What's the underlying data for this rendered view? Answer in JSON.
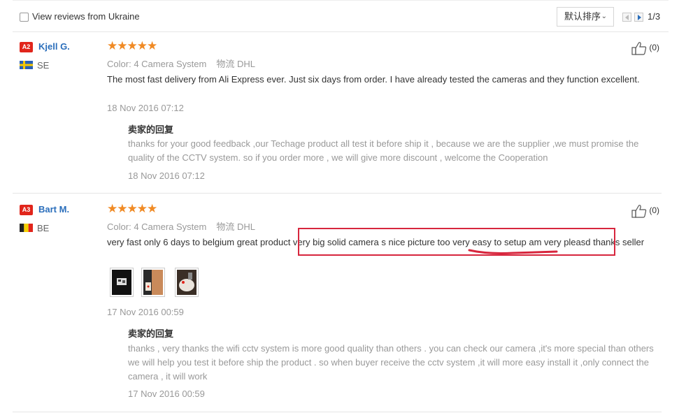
{
  "filter": {
    "label": "View reviews from Ukraine"
  },
  "sort": {
    "label": "默认排序"
  },
  "pagination": {
    "label": "1/3"
  },
  "reviews": [
    {
      "level": "A2",
      "name": "Kjell G.",
      "country": "SE",
      "rating": "★★★★★",
      "color_label": "Color:",
      "color_value": "4 Camera System",
      "ship_label": "物流",
      "ship_value": "DHL",
      "text": "The most fast delivery from Ali Express ever. Just six days from order. I have already tested the cameras and they function excellent.",
      "date": "18 Nov 2016 07:12",
      "helpful": "(0)",
      "reply": {
        "title": "卖家的回复",
        "text": "thanks for your good feedback ,our Techage product all test it before ship it , because we are the supplier ,we must promise the quality of the CCTV system. so if you order more , we will give more discount , welcome the Cooperation",
        "date": "18 Nov 2016 07:12"
      }
    },
    {
      "level": "A3",
      "name": "Bart M.",
      "country": "BE",
      "rating": "★★★★★",
      "color_label": "Color:",
      "color_value": "4 Camera System",
      "ship_label": "物流",
      "ship_value": "DHL",
      "text": "very fast only 6 days to belgium great product very big solid camera s nice picture too very easy to setup am very pleasd thanks seller",
      "date": "17 Nov 2016 00:59",
      "helpful": "(0)",
      "reply": {
        "title": "卖家的回复",
        "text": "thanks , very thanks the wifi cctv system is more good quality than others . you can check our camera ,it's more special than others we will help you test it before ship the product . so when buyer receive the cctv system ,it will more easy install it ,only connect the camera , it will work",
        "date": "17 Nov 2016 00:59"
      }
    }
  ],
  "colors": {
    "link": "#2a6ebb",
    "star": "#f08a24",
    "badge": "#e1251b",
    "annotation": "#d7263d"
  }
}
